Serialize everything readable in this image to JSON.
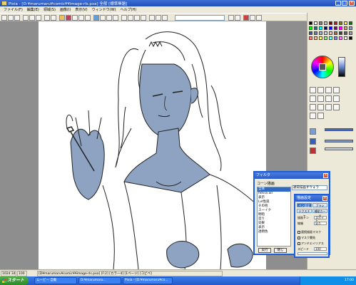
{
  "window": {
    "title": "Pixia - [D:¥marumaru¥comic¥¥image-rls.pxa] 全般 [標準無題]",
    "controls": {
      "minimize": "_",
      "maximize": "□",
      "close": "×"
    }
  },
  "menu": {
    "items": [
      "ファイル(F)",
      "編集(E)",
      "領域(S)",
      "画像(I)",
      "表示(V)",
      "ウィンドウ(W)",
      "ヘルプ(H)"
    ]
  },
  "layer_dialog": {
    "title": "フィルタ",
    "close": "×",
    "filter_label": "コーン描画",
    "selected_mode": "通常描画すウォラ",
    "layers": [
      "全体",
      "fehira all",
      "表示",
      "Lvl性道",
      "その他",
      "スーイク",
      "明暗",
      "塗り",
      "効果",
      "表示",
      "透明色"
    ],
    "ok_label": "実行",
    "close_label": "閉じ"
  },
  "settings_dialog": {
    "title": "描画設定",
    "close": "×",
    "tabs": [
      "ペン設定",
      "ブラシ",
      "テクスチャ",
      "補助カード"
    ],
    "rows": [
      {
        "label": "描画ドン",
        "value": "スポイト"
      },
      {
        "label": "線端",
        "value": "尖り"
      }
    ],
    "checks": [
      "連続描画マスク",
      "マスク貫効",
      "アンチエイリアス"
    ],
    "spacing_label": "スピード",
    "spacing_value": "100"
  },
  "status": {
    "coord": "1024 340",
    "zoom": "100",
    "file": "[D¥marumaru¥comic¥¥image-rls.pxa] [F:2] [カラー4] [1ページ] [コピペ]"
  },
  "taskbar": {
    "start_label": "スタート",
    "tasks": [
      "ムービー 自動",
      "D:¥marumaru...",
      "Pixia - [D:¥marumaru¥co..."
    ],
    "clock": "17:00"
  },
  "colors": {
    "skin_tone": "#8ea2c2",
    "accent": "#1f5ed6",
    "canvas": "#ffffff",
    "workspace": "#8e8e8e"
  }
}
